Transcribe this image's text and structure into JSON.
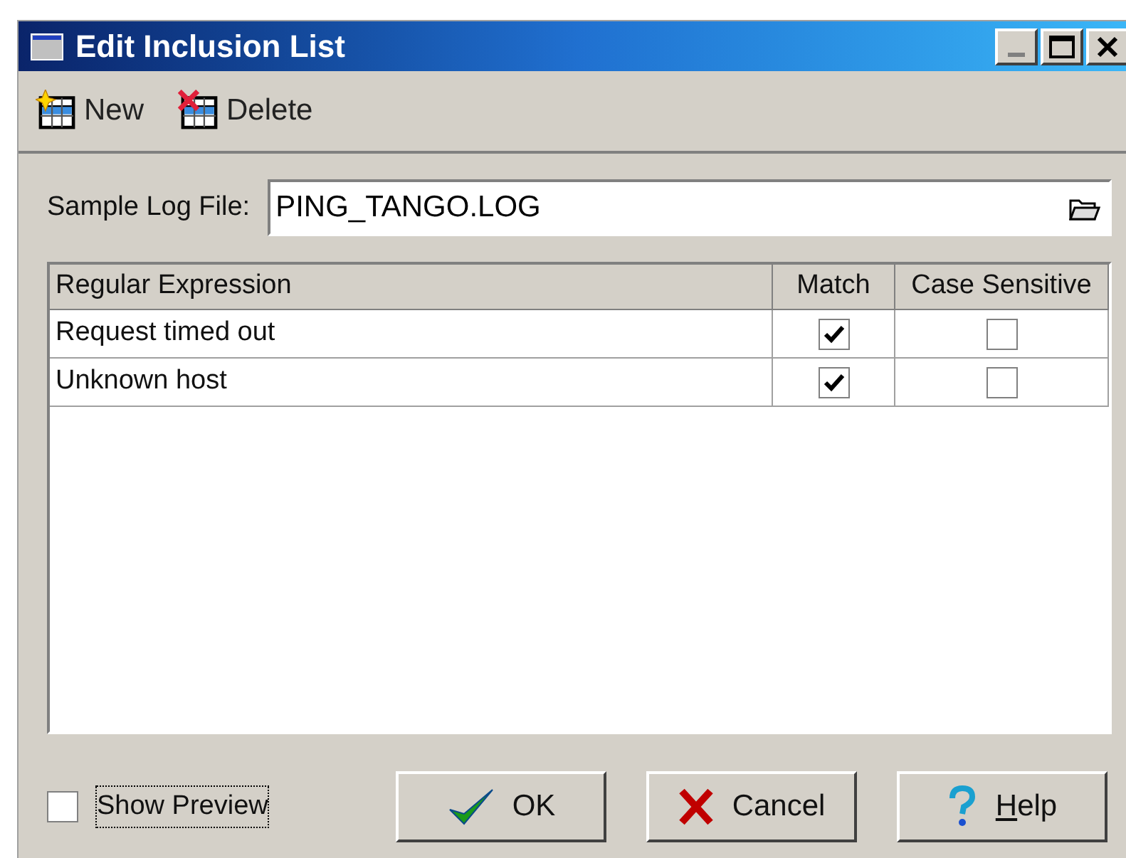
{
  "window": {
    "title": "Edit Inclusion List"
  },
  "toolbar": [
    {
      "kind": "new",
      "label": "New"
    },
    {
      "kind": "delete",
      "label": "Delete"
    }
  ],
  "sample_log_file": {
    "label": "Sample Log File:",
    "value": "PING_TANGO.LOG"
  },
  "table": {
    "columns": [
      "Regular Expression",
      "Match",
      "Case Sensitive"
    ],
    "rows": [
      {
        "expression": "Request timed out",
        "match": true,
        "case_sensitive": false
      },
      {
        "expression": "Unknown host",
        "match": true,
        "case_sensitive": false
      }
    ]
  },
  "show_preview": {
    "label": "Show Preview",
    "checked": false
  },
  "buttons": [
    {
      "kind": "ok",
      "label": "OK"
    },
    {
      "kind": "cancel",
      "label": "Cancel"
    },
    {
      "kind": "help",
      "label": "Help",
      "accelerator_underlined": true
    }
  ]
}
